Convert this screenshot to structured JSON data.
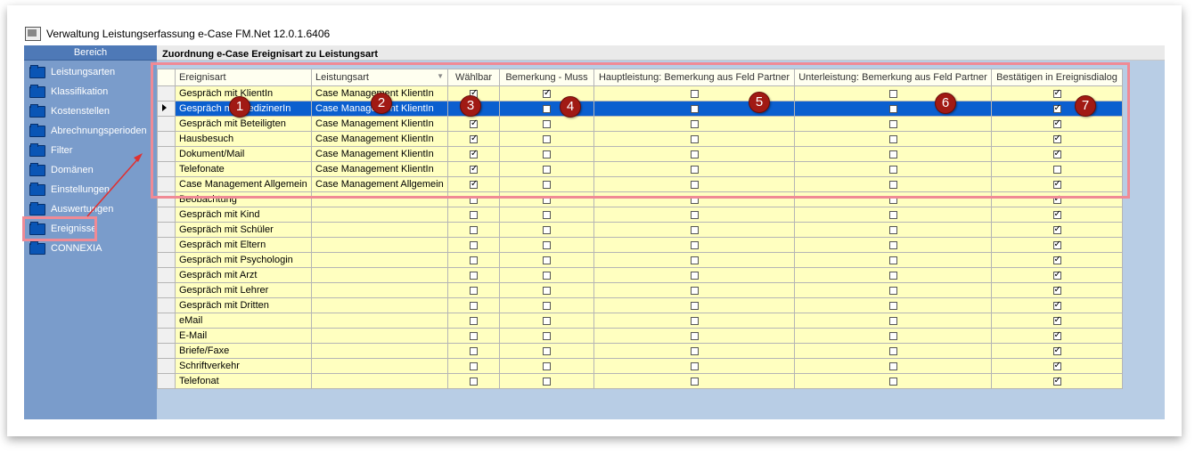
{
  "window": {
    "title": "Verwaltung Leistungserfassung e-Case FM.Net 12.0.1.6406"
  },
  "sidebar": {
    "header": "Bereich",
    "items": [
      {
        "label": "Leistungsarten"
      },
      {
        "label": "Klassifikation"
      },
      {
        "label": "Kostenstellen"
      },
      {
        "label": "Abrechnungsperioden"
      },
      {
        "label": "Filter"
      },
      {
        "label": "Domänen"
      },
      {
        "label": "Einstellungen"
      },
      {
        "label": "Auswertungen"
      },
      {
        "label": "Ereignisse"
      },
      {
        "label": "CONNEXIA"
      }
    ]
  },
  "main": {
    "title": "Zuordnung e-Case Ereignisart zu Leistungsart",
    "columns": [
      "Ereignisart",
      "Leistungsart",
      "Wählbar",
      "Bemerkung - Muss",
      "Hauptleistung: Bemerkung aus Feld Partner",
      "Unterleistung: Bemerkung aus Feld Partner",
      "Bestätigen in Ereignisdialog"
    ],
    "rows": [
      {
        "ereignisart": "Gespräch mit KlientIn",
        "leistungsart": "Case Management KlientIn",
        "waehlbar": true,
        "muss": true,
        "haupt": false,
        "unter": false,
        "bestaetigen": true
      },
      {
        "ereignisart": "Gespräch mit MedizinerIn",
        "leistungsart": "Case Management KlientIn",
        "waehlbar": true,
        "muss": false,
        "haupt": false,
        "unter": false,
        "bestaetigen": true,
        "selected": true
      },
      {
        "ereignisart": "Gespräch mit Beteiligten",
        "leistungsart": "Case Management KlientIn",
        "waehlbar": true,
        "muss": false,
        "haupt": false,
        "unter": false,
        "bestaetigen": true
      },
      {
        "ereignisart": "Hausbesuch",
        "leistungsart": "Case Management KlientIn",
        "waehlbar": true,
        "muss": false,
        "haupt": false,
        "unter": false,
        "bestaetigen": true
      },
      {
        "ereignisart": "Dokument/Mail",
        "leistungsart": "Case Management KlientIn",
        "waehlbar": true,
        "muss": false,
        "haupt": false,
        "unter": false,
        "bestaetigen": true
      },
      {
        "ereignisart": "Telefonate",
        "leistungsart": "Case Management KlientIn",
        "waehlbar": true,
        "muss": false,
        "haupt": false,
        "unter": false,
        "bestaetigen": false
      },
      {
        "ereignisart": "Case Management Allgemein",
        "leistungsart": "Case Management Allgemein",
        "waehlbar": true,
        "muss": false,
        "haupt": false,
        "unter": false,
        "bestaetigen": true
      },
      {
        "ereignisart": "Beobachtung",
        "leistungsart": "",
        "waehlbar": false,
        "muss": false,
        "haupt": false,
        "unter": false,
        "bestaetigen": true
      },
      {
        "ereignisart": "Gespräch mit Kind",
        "leistungsart": "",
        "waehlbar": false,
        "muss": false,
        "haupt": false,
        "unter": false,
        "bestaetigen": true
      },
      {
        "ereignisart": "Gespräch mit Schüler",
        "leistungsart": "",
        "waehlbar": false,
        "muss": false,
        "haupt": false,
        "unter": false,
        "bestaetigen": true
      },
      {
        "ereignisart": "Gespräch mit Eltern",
        "leistungsart": "",
        "waehlbar": false,
        "muss": false,
        "haupt": false,
        "unter": false,
        "bestaetigen": true
      },
      {
        "ereignisart": "Gespräch mit Psychologin",
        "leistungsart": "",
        "waehlbar": false,
        "muss": false,
        "haupt": false,
        "unter": false,
        "bestaetigen": true
      },
      {
        "ereignisart": "Gespräch mit Arzt",
        "leistungsart": "",
        "waehlbar": false,
        "muss": false,
        "haupt": false,
        "unter": false,
        "bestaetigen": true
      },
      {
        "ereignisart": "Gespräch mit Lehrer",
        "leistungsart": "",
        "waehlbar": false,
        "muss": false,
        "haupt": false,
        "unter": false,
        "bestaetigen": true
      },
      {
        "ereignisart": "Gespräch mit Dritten",
        "leistungsart": "",
        "waehlbar": false,
        "muss": false,
        "haupt": false,
        "unter": false,
        "bestaetigen": true
      },
      {
        "ereignisart": "eMail",
        "leistungsart": "",
        "waehlbar": false,
        "muss": false,
        "haupt": false,
        "unter": false,
        "bestaetigen": true
      },
      {
        "ereignisart": "E-Mail",
        "leistungsart": "",
        "waehlbar": false,
        "muss": false,
        "haupt": false,
        "unter": false,
        "bestaetigen": true
      },
      {
        "ereignisart": "Briefe/Faxe",
        "leistungsart": "",
        "waehlbar": false,
        "muss": false,
        "haupt": false,
        "unter": false,
        "bestaetigen": true
      },
      {
        "ereignisart": "Schriftverkehr",
        "leistungsart": "",
        "waehlbar": false,
        "muss": false,
        "haupt": false,
        "unter": false,
        "bestaetigen": true
      },
      {
        "ereignisart": "Telefonat",
        "leistungsart": "",
        "waehlbar": false,
        "muss": false,
        "haupt": false,
        "unter": false,
        "bestaetigen": true
      }
    ]
  },
  "annotations": {
    "badges": [
      "1",
      "2",
      "3",
      "4",
      "5",
      "6",
      "7"
    ]
  },
  "colors": {
    "highlight": "#f08a95",
    "badge": "#a11a14",
    "selection": "#0b5fcf",
    "cell": "#ffffc0",
    "sidebar": "#7a9ccb"
  }
}
